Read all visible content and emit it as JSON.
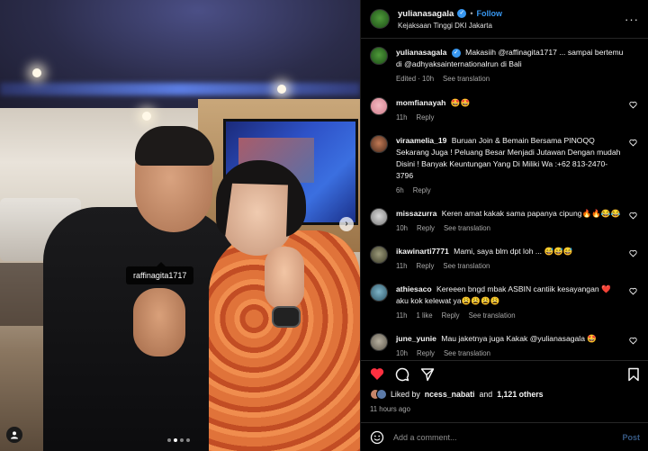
{
  "post_image": {
    "tagged_user": "raffinagita1717",
    "carousel_dots": 4,
    "active_dot": 1
  },
  "header": {
    "username": "yulianasagala",
    "follow_label": "Follow",
    "location": "Kejaksaan Tinggi DKI Jakarta",
    "more_label": "···"
  },
  "caption": {
    "username": "yulianasagala",
    "text": "Makasiih @raffinagita1717 ... sampai bertemu di @adhyaksainternationalrun di Bali",
    "edited": "Edited · 10h",
    "translate": "See translation"
  },
  "comments": [
    {
      "user": "momfianayah",
      "text": "🤩🤩",
      "time": "11h",
      "reply": "Reply",
      "likes": "",
      "translate": ""
    },
    {
      "user": "viraamelia_19",
      "text": "Buruan Join & Bemain Bersama PINOQQ Sekarang Juga ! Peluang Besar Menjadi Jutawan Dengan mudah Disini ! Banyak Keuntungan Yang Di Miliki Wa :+62 813-2470-3796",
      "time": "6h",
      "reply": "Reply",
      "likes": "",
      "translate": ""
    },
    {
      "user": "missazurra",
      "text": "Keren amat kakak sama papanya cipung🔥🔥😂😂",
      "time": "10h",
      "reply": "Reply",
      "likes": "",
      "translate": "See translation"
    },
    {
      "user": "ikawinarti7771",
      "text": "Mami, saya blm dpt loh ... 😅😅😅",
      "time": "11h",
      "reply": "Reply",
      "likes": "",
      "translate": "See translation"
    },
    {
      "user": "athiesaco",
      "text": "Kereeen bngd mbak ASBIN cantiik kesayangan ❤️ aku kok kelewat ya😩😩😩😩",
      "time": "11h",
      "reply": "Reply",
      "likes": "1 like",
      "translate": "See translation"
    },
    {
      "user": "june_yunie",
      "text": "Mau jaketnya juga Kakak @yulianasagala 🤩",
      "time": "10h",
      "reply": "Reply",
      "likes": "",
      "translate": "See translation"
    }
  ],
  "likes": {
    "liked_by_prefix": "Liked by",
    "liked_by_user": "ncess_nabati",
    "and_label": "and",
    "count": "1,121 others"
  },
  "time_ago": "11 hours ago",
  "add_comment": {
    "placeholder": "Add a comment...",
    "post_label": "Post"
  },
  "colors": {
    "accent": "#3897f0",
    "like_red": "#ff3040",
    "background": "#000000"
  }
}
